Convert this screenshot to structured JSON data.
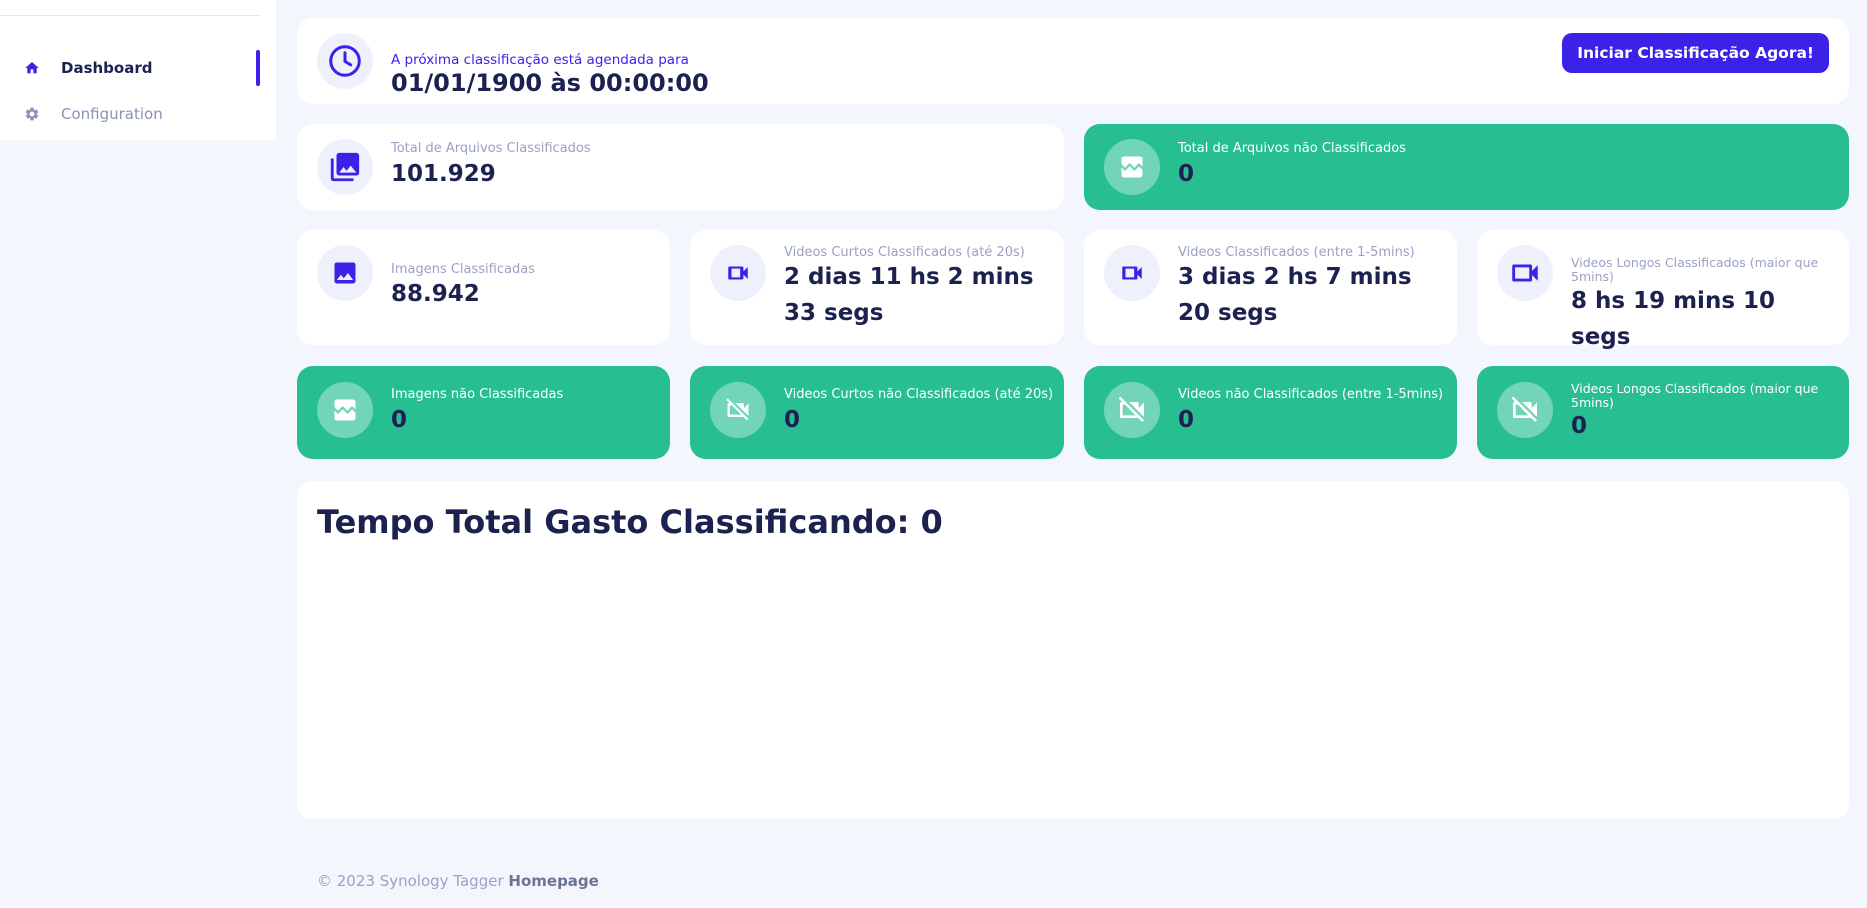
{
  "sidebar": {
    "items": [
      {
        "label": "Dashboard",
        "icon": "home-icon",
        "active": true
      },
      {
        "label": "Configuration",
        "icon": "gear-icon",
        "active": false
      }
    ]
  },
  "schedule": {
    "label": "A próxima classificação está agendada para",
    "value": "01/01/1900 às 00:00:00",
    "button_label": "Iniciar Classificação Agora!",
    "icon": "clock-icon"
  },
  "totals": [
    {
      "label": "Total de Arquivos Classificados",
      "value": "101.929",
      "icon": "photo-library-icon",
      "style": "white"
    },
    {
      "label": "Total de Arquivos não Classificados",
      "value": "0",
      "icon": "broken-image-icon",
      "style": "green"
    }
  ],
  "classified": [
    {
      "label": "Imagens Classificadas",
      "value": "88.942",
      "icon": "image-icon"
    },
    {
      "label": "Videos Curtos Classificados (até 20s)",
      "value": "2 dias 11 hs 2 mins 33 segs",
      "icon": "videocam-icon"
    },
    {
      "label": "Videos Classificados (entre 1-5mins)",
      "value": "3 dias 2 hs 7 mins 20 segs",
      "icon": "videocam-icon"
    },
    {
      "label": "Videos Longos Classificados (maior que 5mins)",
      "value": "8 hs 19 mins 10 segs",
      "icon": "videocam-outline-icon"
    }
  ],
  "unclassified": [
    {
      "label": "Imagens não Classificadas",
      "value": "0",
      "icon": "broken-image-icon"
    },
    {
      "label": "Videos Curtos não Classificados (até 20s)",
      "value": "0",
      "icon": "videocam-off-icon"
    },
    {
      "label": "Videos não Classificados (entre 1-5mins)",
      "value": "0",
      "icon": "videocam-off-icon"
    },
    {
      "label": "Videos Longos Classificados (maior que 5mins)",
      "value": "0",
      "icon": "videocam-off-icon"
    }
  ],
  "time_spent": {
    "title": "Tempo Total Gasto Classificando: 0"
  },
  "footer": {
    "text": "© 2023 Synology Tagger",
    "link": "Homepage"
  },
  "colors": {
    "accent": "#3b22e8",
    "green": "#27bf92",
    "text_dark": "#1b2250",
    "text_muted": "#9aa1c4",
    "background": "#f3f6fd"
  }
}
